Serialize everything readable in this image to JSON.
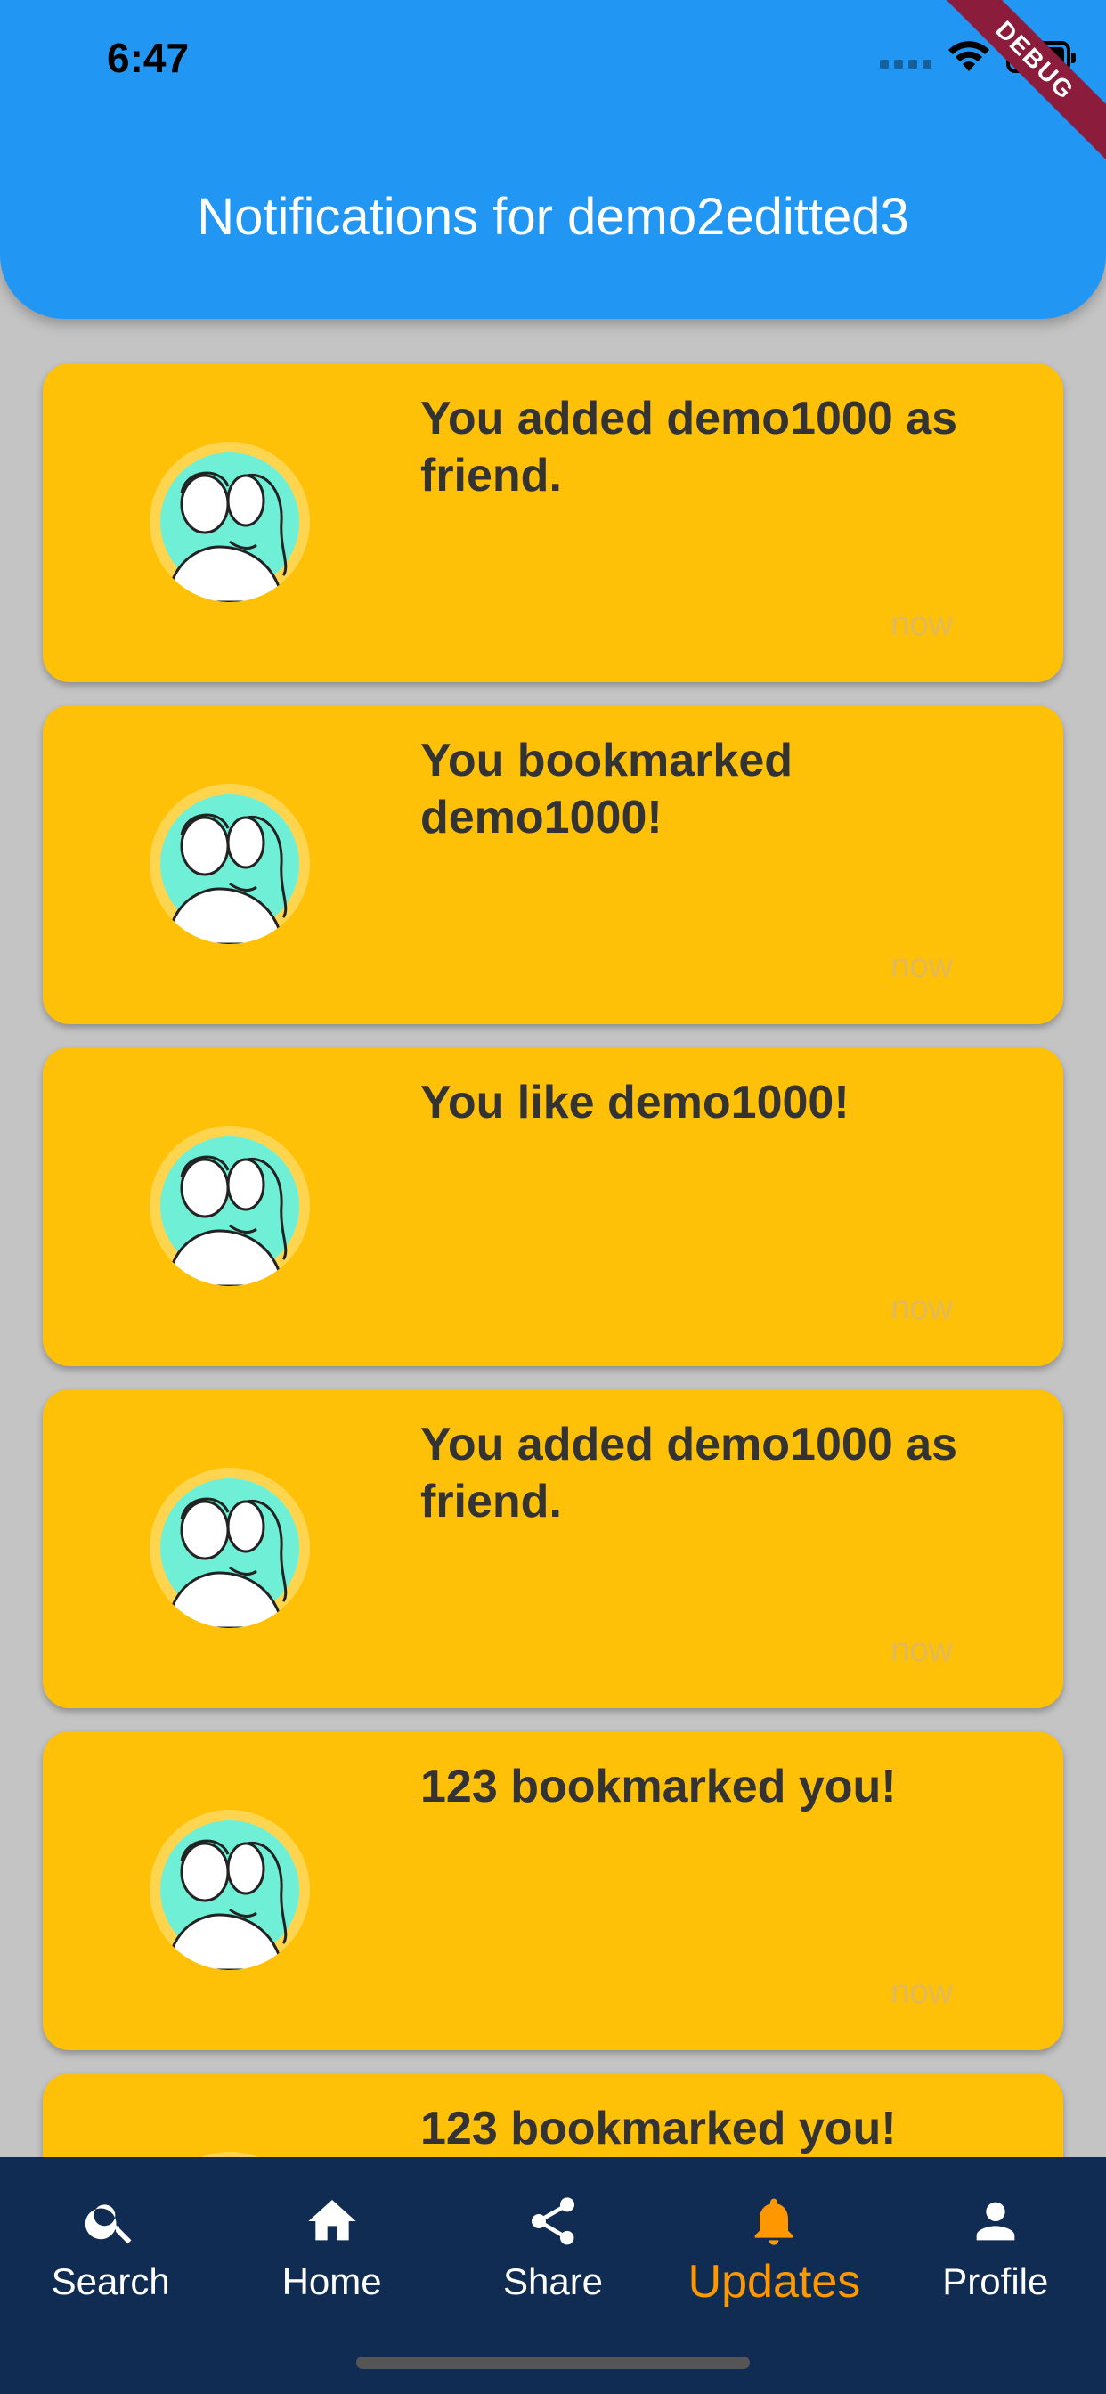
{
  "status_bar": {
    "time": "6:47"
  },
  "debug_banner": "DEBUG",
  "app_bar": {
    "title": "Notifications for demo2editted3"
  },
  "notifications": [
    {
      "message": "You added demo1000 as friend.",
      "time": "now"
    },
    {
      "message": "You bookmarked demo1000!",
      "time": "now"
    },
    {
      "message": "You like demo1000!",
      "time": "now"
    },
    {
      "message": "You added demo1000 as friend.",
      "time": "now"
    },
    {
      "message": "123 bookmarked you!",
      "time": "now"
    },
    {
      "message": "123 bookmarked you!"
    }
  ],
  "bottom_nav": {
    "items": [
      {
        "label": "Search",
        "icon": "search-icon"
      },
      {
        "label": "Home",
        "icon": "home-icon"
      },
      {
        "label": "Share",
        "icon": "share-icon"
      },
      {
        "label": "Updates",
        "icon": "bell-icon",
        "active": true
      },
      {
        "label": "Profile",
        "icon": "person-icon"
      }
    ]
  },
  "colors": {
    "app_bar": "#2196f3",
    "card": "#ffc107",
    "background": "#c4c4c4",
    "nav_background": "#112c52",
    "nav_active": "#ff9800"
  }
}
